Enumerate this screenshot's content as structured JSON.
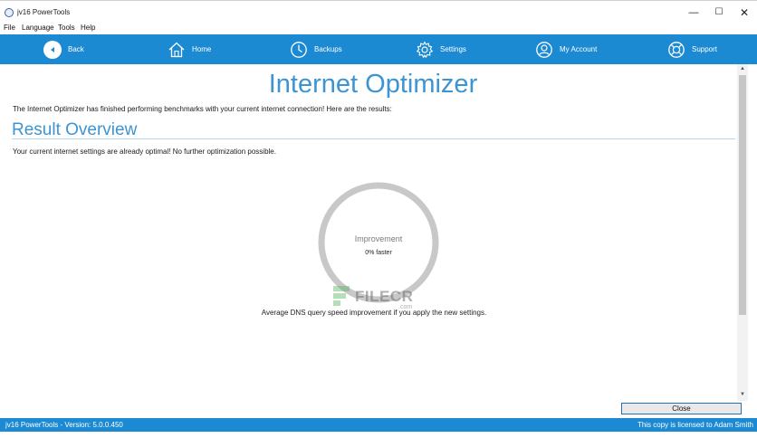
{
  "window": {
    "title": "jv16 PowerTools",
    "minimize": "—",
    "maximize": "☐",
    "close": "✕"
  },
  "menu": [
    "File",
    "Language",
    "Tools",
    "Help"
  ],
  "nav": {
    "back": "Back",
    "home": "Home",
    "backups": "Backups",
    "settings": "Settings",
    "account": "My Account",
    "support": "Support"
  },
  "main": {
    "title": "Internet Optimizer",
    "intro": "The Internet Optimizer has finished performing benchmarks with your current internet connection! Here are the results:",
    "section_title": "Result Overview",
    "status": "Your current internet settings are already optimal! No further optimization possible.",
    "gauge": {
      "label": "Improvement",
      "value": "0% faster",
      "percent": 0,
      "caption": "Average DNS query speed improvement if you apply the new settings."
    }
  },
  "watermark": {
    "text": "FILECR",
    "sub": ".com"
  },
  "scrollbar": {
    "up": "▲",
    "down": "▼"
  },
  "buttons": {
    "close": "Close"
  },
  "statusbar": {
    "version": "jv16 PowerTools - Version: 5.0.0.450",
    "license": "This copy is licensed to Adam Smith"
  },
  "colors": {
    "accent": "#1b8ad2",
    "title_blue": "#3d94d3",
    "gauge_ring": "#c8c8c8"
  }
}
